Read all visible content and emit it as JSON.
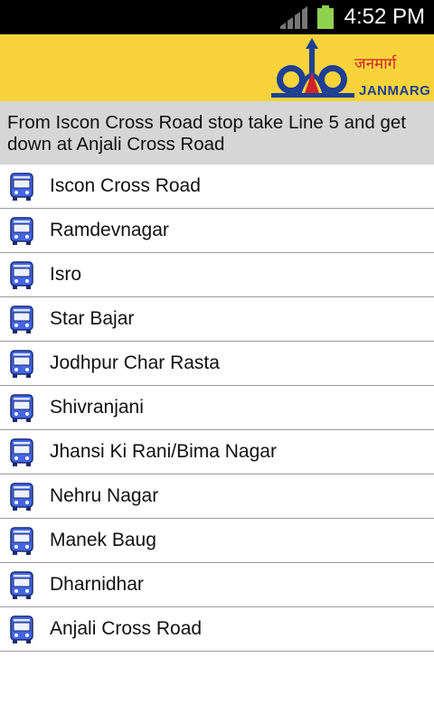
{
  "status_bar": {
    "time": "4:52 PM",
    "icons": [
      "signal-icon",
      "battery-icon"
    ]
  },
  "header": {
    "logo_icon": "janmarg-logo-icon",
    "logo_text_hindi": "जनमार्ग",
    "logo_text_english": "JANMARG",
    "background_color": "#f8d33a"
  },
  "instruction": {
    "text": "From Iscon Cross Road stop take Line 5 and get down at Anjali Cross Road"
  },
  "stops": [
    {
      "name": "Iscon Cross Road"
    },
    {
      "name": "Ramdevnagar"
    },
    {
      "name": "Isro"
    },
    {
      "name": "Star Bajar"
    },
    {
      "name": "Jodhpur Char Rasta"
    },
    {
      "name": "Shivranjani"
    },
    {
      "name": "Jhansi Ki Rani/Bima Nagar"
    },
    {
      "name": "Nehru Nagar"
    },
    {
      "name": "Manek Baug"
    },
    {
      "name": "Dharnidhar"
    },
    {
      "name": "Anjali Cross Road"
    }
  ],
  "stop_icon": "bus-icon"
}
